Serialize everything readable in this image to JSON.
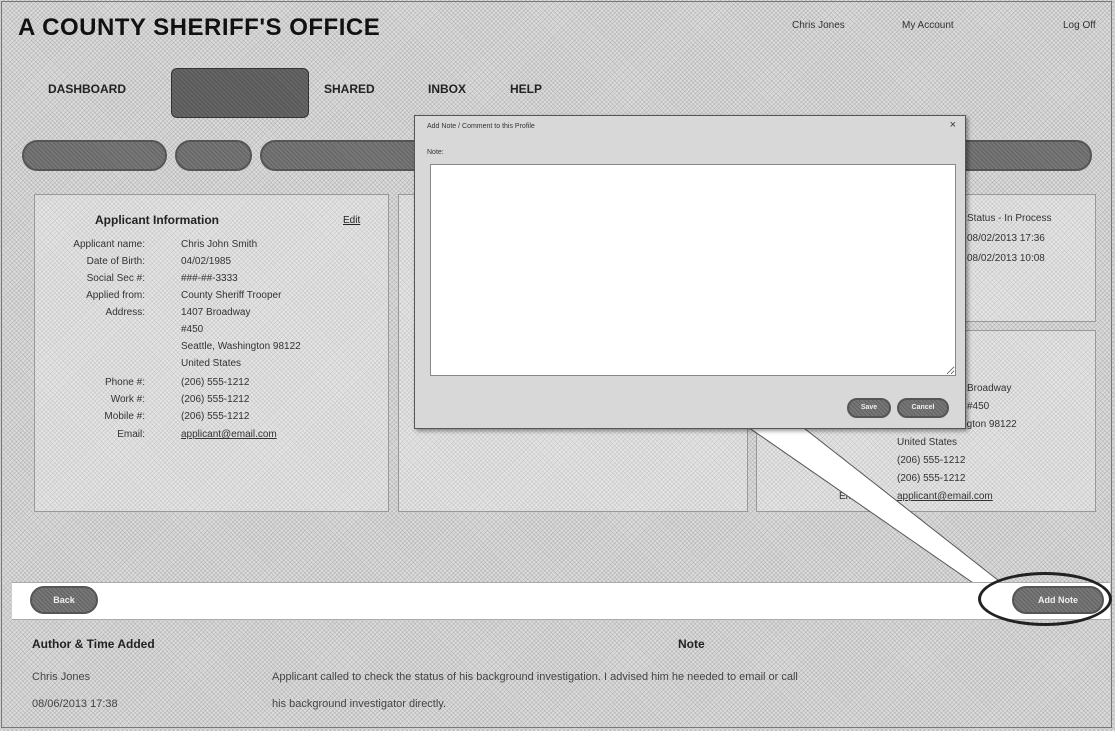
{
  "header": {
    "app_title": "A COUNTY SHERIFF'S OFFICE",
    "user_name": "Chris Jones",
    "my_account": "My Account",
    "log_off": "Log Off"
  },
  "nav": {
    "tabs": [
      {
        "label": "DASHBOARD"
      },
      {
        "label": ""
      },
      {
        "label": "SHARED"
      },
      {
        "label": "INBOX"
      },
      {
        "label": "HELP"
      }
    ]
  },
  "applicant": {
    "title": "Applicant Information",
    "edit_label": "Edit",
    "labels": {
      "name": "Applicant name:",
      "dob": "Date of Birth:",
      "ssn": "Social Sec #:",
      "applied_from": "Applied from:",
      "address": "Address:",
      "phone": "Phone #:",
      "work": "Work #:",
      "mobile": "Mobile #:",
      "email": "Email:"
    },
    "values": {
      "name": "Chris John Smith",
      "dob": "04/02/1985",
      "ssn": "###-##-3333",
      "applied_from": "County Sheriff Trooper",
      "address_line1": "1407 Broadway",
      "address_line2": "#450",
      "address_line3": "Seattle, Washington 98122",
      "address_line4": "United States",
      "phone": "(206) 555-1212",
      "work": "(206) 555-1212",
      "mobile": "(206) 555-1212",
      "email": "applicant@email.com"
    }
  },
  "right_panel": {
    "status_line": "Status - In Process",
    "date1": "08/02/2013 17:36",
    "date2": "08/02/2013 10:08",
    "address_line1": "Broadway",
    "address_line2": "#450",
    "address_line3": "Seattle, Washington 98122",
    "address_line4": "United States",
    "phone1": "(206) 555-1212",
    "phone2": "(206) 555-1212",
    "email_label": "Email:",
    "email": "applicant@email.com"
  },
  "modal": {
    "title": "Add Note / Comment to this Profile",
    "close_label": "×",
    "note_label": "Note:",
    "note_value": "",
    "save_label": "Save",
    "cancel_label": "Cancel"
  },
  "notes": {
    "back_label": "Back",
    "add_note_label": "Add Note",
    "col_author": "Author & Time Added",
    "col_note": "Note",
    "rows": [
      {
        "author": "Chris Jones",
        "time": "08/06/2013 17:38",
        "note_line1": "Applicant called to check the status of his background investigation. I advised him he needed to email or call",
        "note_line2": "his background investigator directly."
      }
    ]
  }
}
